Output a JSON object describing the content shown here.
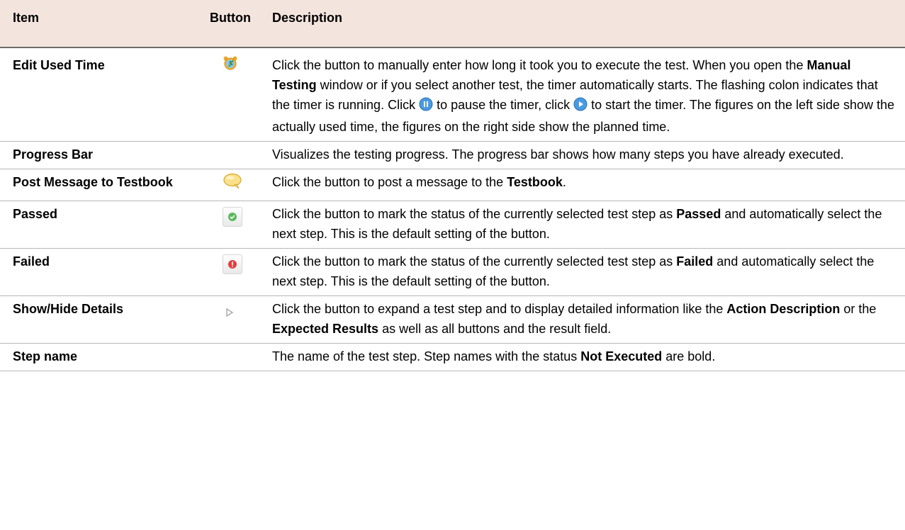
{
  "headers": {
    "item": "Item",
    "button": "Button",
    "description": "Description"
  },
  "rows": [
    {
      "item": "Edit Used Time",
      "icon": "alarm-clock-icon",
      "desc": {
        "t1": "Click the button to manually enter how long it took you to execute the test. When you open the ",
        "b1": "Manual Testing",
        "t2": " window or if you select another test, the timer automatically starts. The flashing colon indicates that the timer is running. Click ",
        "t3": " to pause the timer, click ",
        "t4": " to start the timer. The figures on the left side show the actually used time, the figures on the right side show the planned time."
      }
    },
    {
      "item": "Progress Bar",
      "icon": "",
      "desc": {
        "t1": "Visualizes the testing progress. The progress bar shows how many steps you have already executed."
      }
    },
    {
      "item": "Post Message to Testbook",
      "icon": "speech-bubble-icon",
      "desc": {
        "t1": "Click the button to post a message to the ",
        "b1": "Testbook",
        "t2": "."
      }
    },
    {
      "item": "Passed",
      "icon": "check-circle-icon",
      "desc": {
        "t1": "Click the button to mark the status of the currently selected test step as ",
        "b1": "Passed",
        "t2": " and automatically select the next step. This is the default setting of the button."
      }
    },
    {
      "item": "Failed",
      "icon": "exclamation-circle-icon",
      "desc": {
        "t1": "Click the button to mark the status of the currently selected test step as ",
        "b1": "Failed",
        "t2": " and automatically select the next step. This is the default setting of the button."
      }
    },
    {
      "item": "Show/Hide Details",
      "icon": "triangle-right-icon",
      "desc": {
        "t1": "Click the button to expand a test step and to display detailed information like the ",
        "b1": "Action Description",
        "t2": " or the ",
        "b2": "Expected Results",
        "t3": " as well as all buttons and the result field."
      }
    },
    {
      "item": "Step name",
      "icon": "",
      "desc": {
        "t1": "The name of the test step. Step names with the status ",
        "b1": "Not Executed",
        "t2": " are bold."
      }
    }
  ],
  "colors": {
    "header_bg": "#f3e4dd",
    "passed_green": "#5cb85c",
    "failed_red": "#e04040",
    "play_blue": "#3a8fd8"
  }
}
